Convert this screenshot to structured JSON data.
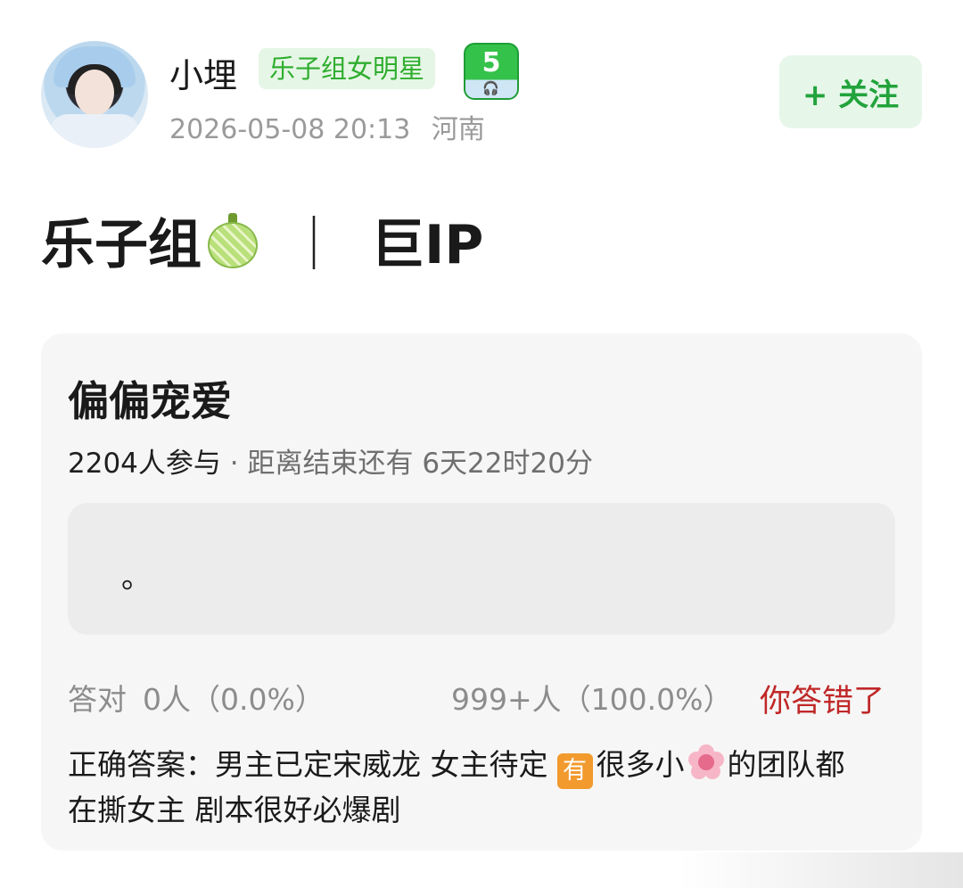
{
  "post": {
    "author": {
      "name": "小埋",
      "tag": "乐子组女明星",
      "level": "5"
    },
    "time": "2026-05-08 20:13",
    "location": "河南",
    "follow_label": "+ 关注",
    "title": {
      "prefix": "乐子组",
      "emoji": "melon-icon",
      "separator": "｜",
      "suffix": "巨IP"
    }
  },
  "poll": {
    "title": "偏偏宠爱",
    "participants": "2204人参与",
    "dot": " · ",
    "deadline": "距离结束还有 6天22时20分",
    "option_text": "。",
    "correct_label": "答对",
    "correct_count": "0人（0.0%）",
    "wrong_count": "999+人（100.0%）",
    "result": "你答错了",
    "answer": {
      "part1": "正确答案：男主已定宋威龙 女主待定",
      "badge": "有",
      "part2": "很多小",
      "flower_icon": "cherry-blossom-icon",
      "part3": "的团队都在撕女主 剧本很好必爆剧"
    }
  },
  "colors": {
    "accent_green": "#22a33c",
    "tag_green": "#2fae2f",
    "wrong_red": "#c02828",
    "card_bg": "#f6f6f6"
  }
}
